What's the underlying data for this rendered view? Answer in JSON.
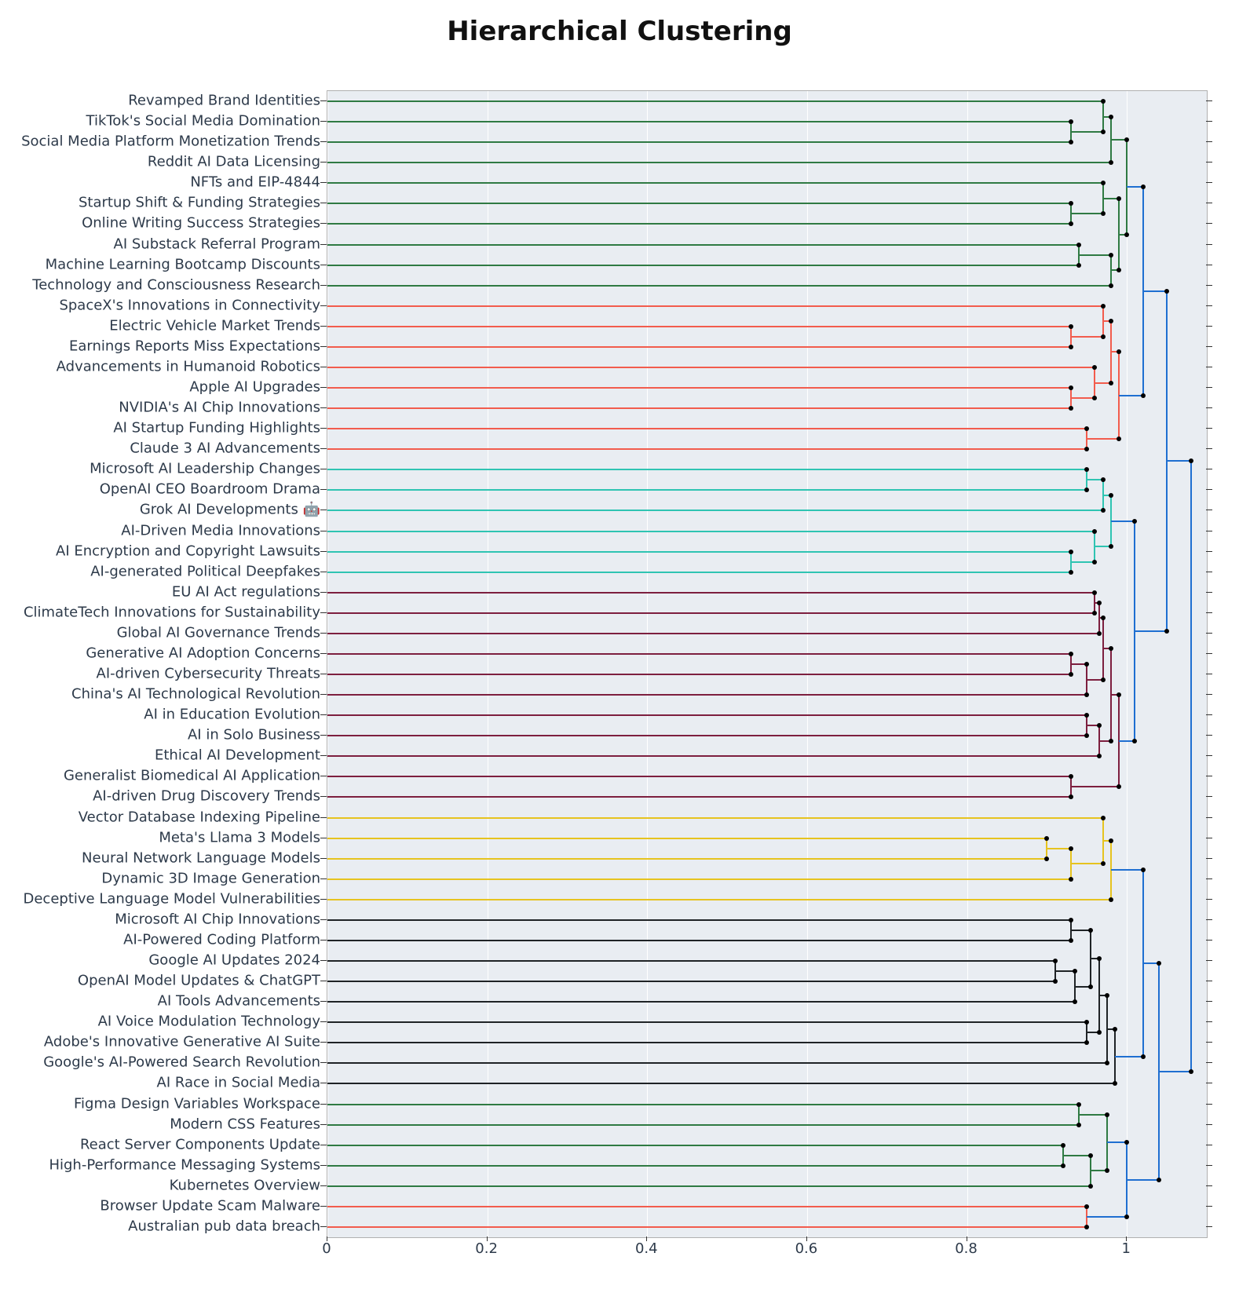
{
  "chart_data": {
    "type": "dendrogram",
    "title": "Hierarchical Clustering",
    "xlabel": "",
    "ylabel": "",
    "xlim": [
      0,
      1.1
    ],
    "x_ticks": [
      0,
      0.2,
      0.4,
      0.6,
      0.8,
      1
    ],
    "labels": [
      "Revamped Brand Identities",
      "TikTok's Social Media Domination",
      "Social Media Platform Monetization Trends",
      "Reddit AI Data Licensing",
      "NFTs and EIP-4844",
      "Startup Shift & Funding Strategies",
      "Online Writing Success Strategies",
      "AI Substack Referral Program",
      "Machine Learning Bootcamp Discounts",
      "Technology and Consciousness Research",
      "SpaceX's Innovations in Connectivity",
      "Electric Vehicle Market Trends",
      "Earnings Reports Miss Expectations",
      "Advancements in Humanoid Robotics",
      "Apple AI Upgrades",
      "NVIDIA's AI Chip Innovations",
      "AI Startup Funding Highlights",
      "Claude 3 AI Advancements",
      "Microsoft AI Leadership Changes",
      "OpenAI CEO Boardroom Drama",
      "Grok AI Developments 🤖",
      "AI-Driven Media Innovations",
      "AI Encryption and Copyright Lawsuits",
      "AI-generated Political Deepfakes",
      "EU AI Act regulations",
      "ClimateTech Innovations for Sustainability",
      "Global AI Governance Trends",
      "Generative AI Adoption Concerns",
      "AI-driven Cybersecurity Threats",
      "China's AI Technological Revolution",
      "AI in Education Evolution",
      "AI in Solo Business",
      "Ethical AI Development",
      "Generalist Biomedical AI Application",
      "AI-driven Drug Discovery Trends",
      "Vector Database Indexing Pipeline",
      "Meta's Llama 3 Models",
      "Neural Network Language Models",
      "Dynamic 3D Image Generation",
      "Deceptive Language Model Vulnerabilities",
      "Microsoft AI Chip Innovations",
      "AI-Powered Coding Platform",
      "Google AI Updates 2024",
      "OpenAI Model Updates & ChatGPT",
      "AI Tools Advancements",
      "AI Voice Modulation Technology",
      "Adobe's Innovative Generative AI Suite",
      "Google's AI-Powered Search Revolution",
      "AI Race in Social Media",
      "Figma Design Variables Workspace",
      "Modern CSS Features",
      "React Server Components Update",
      "High-Performance Messaging Systems",
      "Kubernetes Overview",
      "Browser Update Scam Malware",
      "Australian pub data breach"
    ],
    "leaf_clusters": [
      "green",
      "green",
      "green",
      "green",
      "green",
      "green",
      "green",
      "green",
      "green",
      "green",
      "red",
      "red",
      "red",
      "red",
      "red",
      "red",
      "red",
      "red",
      "teal",
      "teal",
      "teal",
      "teal",
      "teal",
      "teal",
      "maroon",
      "maroon",
      "maroon",
      "maroon",
      "maroon",
      "maroon",
      "maroon",
      "maroon",
      "maroon",
      "maroon",
      "maroon",
      "gold",
      "gold",
      "gold",
      "gold",
      "gold",
      "black",
      "black",
      "black",
      "black",
      "black",
      "black",
      "black",
      "black",
      "black",
      "green",
      "green",
      "green",
      "green",
      "green",
      "red",
      "red"
    ],
    "cluster_colors": {
      "green": "#2f7a43",
      "red": "#f25c4d",
      "teal": "#2fc4b2",
      "maroon": "#7d1f3f",
      "gold": "#e6c31f",
      "black": "#1f2326",
      "blue": "#1f6fd1"
    },
    "merges": [
      {
        "left": {
          "leaf": 1
        },
        "right": {
          "leaf": 2
        },
        "dist": 0.93,
        "color": "green",
        "id": "g1"
      },
      {
        "left": {
          "leaf": 0
        },
        "right": {
          "ref": "g1"
        },
        "dist": 0.97,
        "color": "green",
        "id": "g2"
      },
      {
        "left": {
          "ref": "g2"
        },
        "right": {
          "leaf": 3
        },
        "dist": 0.98,
        "color": "green",
        "id": "g3"
      },
      {
        "left": {
          "leaf": 5
        },
        "right": {
          "leaf": 6
        },
        "dist": 0.93,
        "color": "green",
        "id": "g4"
      },
      {
        "left": {
          "leaf": 4
        },
        "right": {
          "ref": "g4"
        },
        "dist": 0.97,
        "color": "green",
        "id": "g5"
      },
      {
        "left": {
          "leaf": 7
        },
        "right": {
          "leaf": 8
        },
        "dist": 0.94,
        "color": "green",
        "id": "g6"
      },
      {
        "left": {
          "ref": "g6"
        },
        "right": {
          "leaf": 9
        },
        "dist": 0.98,
        "color": "green",
        "id": "g7"
      },
      {
        "left": {
          "ref": "g5"
        },
        "right": {
          "ref": "g7"
        },
        "dist": 0.99,
        "color": "green",
        "id": "g8"
      },
      {
        "left": {
          "ref": "g3"
        },
        "right": {
          "ref": "g8"
        },
        "dist": 1.0,
        "color": "green",
        "id": "g9"
      },
      {
        "left": {
          "leaf": 11
        },
        "right": {
          "leaf": 12
        },
        "dist": 0.93,
        "color": "red",
        "id": "r1"
      },
      {
        "left": {
          "leaf": 10
        },
        "right": {
          "ref": "r1"
        },
        "dist": 0.97,
        "color": "red",
        "id": "r2"
      },
      {
        "left": {
          "leaf": 14
        },
        "right": {
          "leaf": 15
        },
        "dist": 0.93,
        "color": "red",
        "id": "r3"
      },
      {
        "left": {
          "leaf": 13
        },
        "right": {
          "ref": "r3"
        },
        "dist": 0.96,
        "color": "red",
        "id": "r4"
      },
      {
        "left": {
          "ref": "r2"
        },
        "right": {
          "ref": "r4"
        },
        "dist": 0.98,
        "color": "red",
        "id": "r5"
      },
      {
        "left": {
          "leaf": 16
        },
        "right": {
          "leaf": 17
        },
        "dist": 0.95,
        "color": "red",
        "id": "r6"
      },
      {
        "left": {
          "ref": "r5"
        },
        "right": {
          "ref": "r6"
        },
        "dist": 0.99,
        "color": "red",
        "id": "r7"
      },
      {
        "left": {
          "ref": "g9"
        },
        "right": {
          "ref": "r7"
        },
        "dist": 1.02,
        "color": "blue",
        "id": "b1"
      },
      {
        "left": {
          "leaf": 18
        },
        "right": {
          "leaf": 19
        },
        "dist": 0.95,
        "color": "teal",
        "id": "t1"
      },
      {
        "left": {
          "ref": "t1"
        },
        "right": {
          "leaf": 20
        },
        "dist": 0.97,
        "color": "teal",
        "id": "t2"
      },
      {
        "left": {
          "leaf": 22
        },
        "right": {
          "leaf": 23
        },
        "dist": 0.93,
        "color": "teal",
        "id": "t3"
      },
      {
        "left": {
          "leaf": 21
        },
        "right": {
          "ref": "t3"
        },
        "dist": 0.96,
        "color": "teal",
        "id": "t4"
      },
      {
        "left": {
          "ref": "t2"
        },
        "right": {
          "ref": "t4"
        },
        "dist": 0.98,
        "color": "teal",
        "id": "t5"
      },
      {
        "left": {
          "leaf": 24
        },
        "right": {
          "leaf": 25
        },
        "dist": 0.96,
        "color": "maroon",
        "id": "m1"
      },
      {
        "left": {
          "ref": "m1"
        },
        "right": {
          "leaf": 26
        },
        "dist": 0.965,
        "color": "maroon",
        "id": "m2"
      },
      {
        "left": {
          "leaf": 27
        },
        "right": {
          "leaf": 28
        },
        "dist": 0.93,
        "color": "maroon",
        "id": "m3"
      },
      {
        "left": {
          "ref": "m3"
        },
        "right": {
          "leaf": 29
        },
        "dist": 0.95,
        "color": "maroon",
        "id": "m4"
      },
      {
        "left": {
          "ref": "m2"
        },
        "right": {
          "ref": "m4"
        },
        "dist": 0.97,
        "color": "maroon",
        "id": "m5"
      },
      {
        "left": {
          "leaf": 30
        },
        "right": {
          "leaf": 31
        },
        "dist": 0.95,
        "color": "maroon",
        "id": "m6"
      },
      {
        "left": {
          "ref": "m6"
        },
        "right": {
          "leaf": 32
        },
        "dist": 0.965,
        "color": "maroon",
        "id": "m7"
      },
      {
        "left": {
          "ref": "m5"
        },
        "right": {
          "ref": "m7"
        },
        "dist": 0.98,
        "color": "maroon",
        "id": "m8"
      },
      {
        "left": {
          "leaf": 33
        },
        "right": {
          "leaf": 34
        },
        "dist": 0.93,
        "color": "maroon",
        "id": "m9"
      },
      {
        "left": {
          "ref": "m8"
        },
        "right": {
          "ref": "m9"
        },
        "dist": 0.99,
        "color": "maroon",
        "id": "m10"
      },
      {
        "left": {
          "ref": "t5"
        },
        "right": {
          "ref": "m10"
        },
        "dist": 1.01,
        "color": "blue",
        "id": "b2"
      },
      {
        "left": {
          "ref": "b1"
        },
        "right": {
          "ref": "b2"
        },
        "dist": 1.05,
        "color": "blue",
        "id": "b3"
      },
      {
        "left": {
          "leaf": 36
        },
        "right": {
          "leaf": 37
        },
        "dist": 0.9,
        "color": "gold",
        "id": "y1"
      },
      {
        "left": {
          "ref": "y1"
        },
        "right": {
          "leaf": 38
        },
        "dist": 0.93,
        "color": "gold",
        "id": "y2"
      },
      {
        "left": {
          "leaf": 35
        },
        "right": {
          "ref": "y2"
        },
        "dist": 0.97,
        "color": "gold",
        "id": "y3"
      },
      {
        "left": {
          "ref": "y3"
        },
        "right": {
          "leaf": 39
        },
        "dist": 0.98,
        "color": "gold",
        "id": "y4"
      },
      {
        "left": {
          "leaf": 40
        },
        "right": {
          "leaf": 41
        },
        "dist": 0.93,
        "color": "black",
        "id": "k1"
      },
      {
        "left": {
          "leaf": 42
        },
        "right": {
          "leaf": 43
        },
        "dist": 0.91,
        "color": "black",
        "id": "k2"
      },
      {
        "left": {
          "ref": "k2"
        },
        "right": {
          "leaf": 44
        },
        "dist": 0.935,
        "color": "black",
        "id": "k3"
      },
      {
        "left": {
          "ref": "k1"
        },
        "right": {
          "ref": "k3"
        },
        "dist": 0.955,
        "color": "black",
        "id": "k4"
      },
      {
        "left": {
          "leaf": 45
        },
        "right": {
          "leaf": 46
        },
        "dist": 0.95,
        "color": "black",
        "id": "k5"
      },
      {
        "left": {
          "ref": "k4"
        },
        "right": {
          "ref": "k5"
        },
        "dist": 0.965,
        "color": "black",
        "id": "k6"
      },
      {
        "left": {
          "ref": "k6"
        },
        "right": {
          "leaf": 47
        },
        "dist": 0.975,
        "color": "black",
        "id": "k7"
      },
      {
        "left": {
          "ref": "k7"
        },
        "right": {
          "leaf": 48
        },
        "dist": 0.985,
        "color": "black",
        "id": "k8"
      },
      {
        "left": {
          "ref": "y4"
        },
        "right": {
          "ref": "k8"
        },
        "dist": 1.02,
        "color": "blue",
        "id": "b4"
      },
      {
        "left": {
          "leaf": 49
        },
        "right": {
          "leaf": 50
        },
        "dist": 0.94,
        "color": "green",
        "id": "c1"
      },
      {
        "left": {
          "leaf": 51
        },
        "right": {
          "leaf": 52
        },
        "dist": 0.92,
        "color": "green",
        "id": "c2"
      },
      {
        "left": {
          "ref": "c2"
        },
        "right": {
          "leaf": 53
        },
        "dist": 0.955,
        "color": "green",
        "id": "c3"
      },
      {
        "left": {
          "ref": "c1"
        },
        "right": {
          "ref": "c3"
        },
        "dist": 0.975,
        "color": "green",
        "id": "c4"
      },
      {
        "left": {
          "leaf": 54
        },
        "right": {
          "leaf": 55
        },
        "dist": 0.95,
        "color": "red",
        "id": "s1"
      },
      {
        "left": {
          "ref": "c4"
        },
        "right": {
          "ref": "s1"
        },
        "dist": 1.0,
        "color": "blue",
        "id": "b5"
      },
      {
        "left": {
          "ref": "b4"
        },
        "right": {
          "ref": "b5"
        },
        "dist": 1.04,
        "color": "blue",
        "id": "b6"
      },
      {
        "left": {
          "ref": "b3"
        },
        "right": {
          "ref": "b6"
        },
        "dist": 1.08,
        "color": "blue",
        "id": "b7"
      }
    ]
  }
}
